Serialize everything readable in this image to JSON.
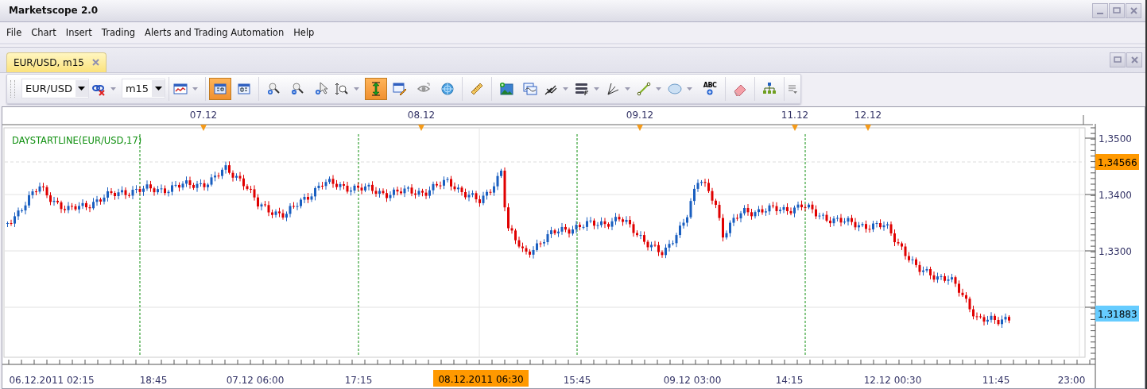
{
  "window": {
    "title": "Marketscope 2.0"
  },
  "menu": [
    "File",
    "Chart",
    "Insert",
    "Trading",
    "Alerts and Trading Automation",
    "Help"
  ],
  "tabs": [
    {
      "label": "EUR/USD, m15",
      "selected": true
    }
  ],
  "toolbar": {
    "groups": [
      [
        {
          "kind": "select",
          "value": "EUR/USD"
        },
        {
          "kind": "button",
          "active": false,
          "dropdown": true
        },
        {
          "kind": "select",
          "value": "m15"
        }
      ],
      [
        {
          "kind": "button",
          "active": false,
          "dropdown": true
        }
      ],
      [
        {
          "kind": "button",
          "active": true,
          "dropdown": false
        },
        {
          "kind": "button",
          "active": false,
          "dropdown": false
        }
      ],
      [
        {
          "kind": "button",
          "active": false,
          "dropdown": false
        },
        {
          "kind": "button",
          "active": false,
          "dropdown": false
        },
        {
          "kind": "button",
          "active": false,
          "dropdown": false
        },
        {
          "kind": "button",
          "active": false,
          "dropdown": true
        },
        {
          "kind": "button",
          "active": true,
          "dropdown": false
        },
        {
          "kind": "button",
          "active": false,
          "dropdown": false
        },
        {
          "kind": "button",
          "active": false,
          "dropdown": false
        },
        {
          "kind": "button",
          "active": false,
          "dropdown": false
        }
      ],
      [
        {
          "kind": "button",
          "active": false,
          "dropdown": false
        }
      ],
      [
        {
          "kind": "button",
          "active": false,
          "dropdown": false
        },
        {
          "kind": "button",
          "active": false,
          "dropdown": false
        },
        {
          "kind": "button",
          "active": false,
          "dropdown": true
        },
        {
          "kind": "button",
          "active": false,
          "dropdown": true
        },
        {
          "kind": "button",
          "active": false,
          "dropdown": true
        },
        {
          "kind": "button",
          "active": false,
          "dropdown": true
        },
        {
          "kind": "button",
          "active": false,
          "dropdown": true
        },
        {
          "kind": "button",
          "active": false,
          "dropdown": false,
          "label": "ABC"
        }
      ],
      [
        {
          "kind": "button",
          "active": false,
          "dropdown": false
        }
      ],
      [
        {
          "kind": "button",
          "active": false,
          "dropdown": false
        }
      ]
    ]
  },
  "chart": {
    "indicator_label": "DAYSTARTLINE(EUR/USD,17)",
    "date_markers": [
      "07.12",
      "08.12",
      "09.12",
      "11.12",
      "12.12"
    ],
    "price_ticks": [
      "1,3500",
      "1,3400",
      "1,3300"
    ],
    "price_badges": [
      {
        "text": "1,34566",
        "color": "#ff9900"
      },
      {
        "text": "1,31883",
        "color": "#66ccff"
      }
    ],
    "time_labels": [
      "06.12.2011 02:15",
      "18:45",
      "07.12 06:00",
      "17:15",
      "15:45",
      "09.12 03:00",
      "14:15",
      "12.12 00:30",
      "11:45",
      "23:00"
    ],
    "cursor_time": "08.12.2011 06:30"
  }
}
